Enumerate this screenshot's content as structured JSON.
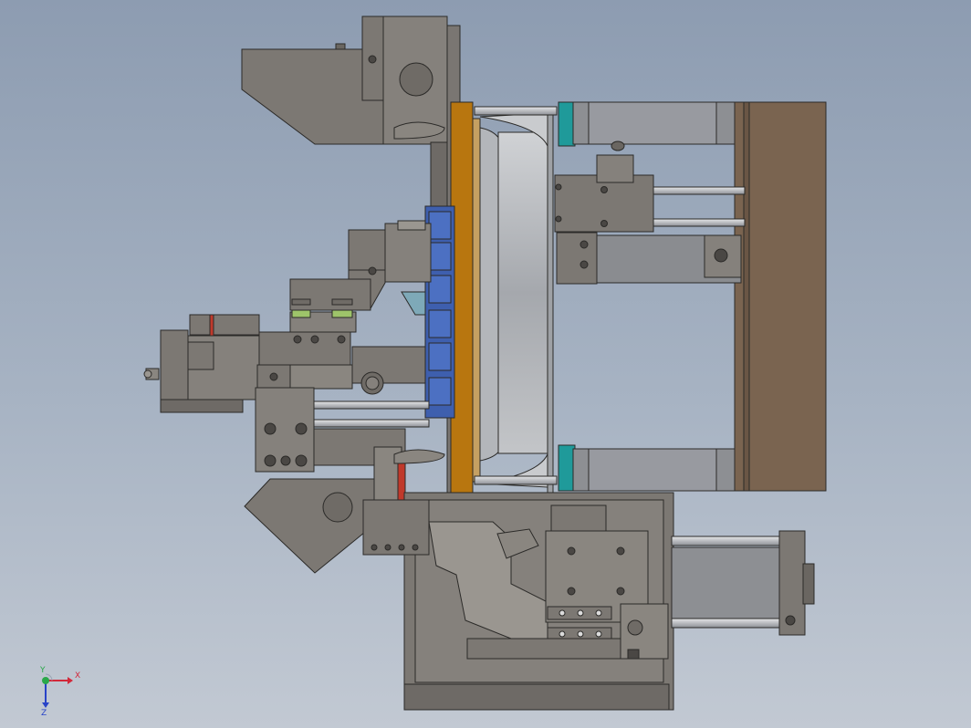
{
  "viewport": {
    "title": "",
    "background_top": "#8d9cb1",
    "background_bottom": "#c2c9d3"
  },
  "colors": {
    "body_gray": "#7c7873",
    "dark_gray": "#5a5753",
    "light_gray": "#9a9690",
    "steel": "#b9bcc0",
    "orange_plate": "#b8760f",
    "brown_plate": "#7a6450",
    "blue_block": "#3e5fae",
    "teal_ring": "#1f9a9a",
    "green_pad": "#9ec46a",
    "red_mark": "#c0392b",
    "cylinder": "#8d8f93"
  },
  "triad": {
    "x_label": "X",
    "y_label": "Y",
    "z_label": "Z",
    "x_color": "#d2283a",
    "y_color": "#2aa84a",
    "z_color": "#2843c8"
  }
}
